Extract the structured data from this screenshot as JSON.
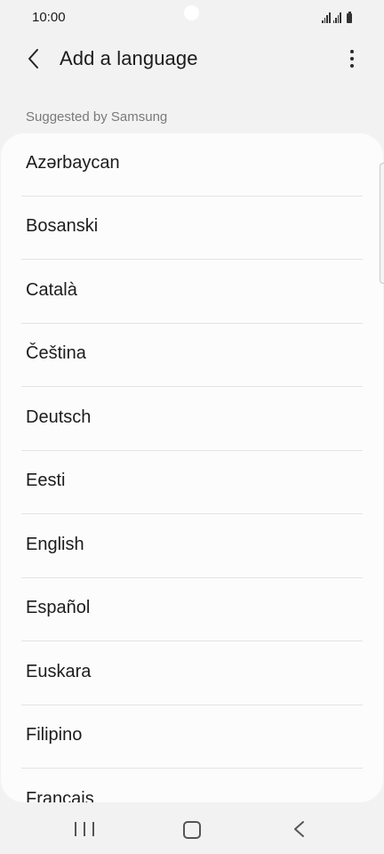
{
  "status_bar": {
    "time": "10:00"
  },
  "header": {
    "title": "Add a language",
    "back_icon": "chevron-left-icon",
    "more_icon": "more-vert-icon"
  },
  "section": {
    "title": "Suggested by Samsung"
  },
  "languages": [
    {
      "label": "Azərbaycan"
    },
    {
      "label": "Bosanski"
    },
    {
      "label": "Català"
    },
    {
      "label": "Čeština"
    },
    {
      "label": "Deutsch"
    },
    {
      "label": "Eesti"
    },
    {
      "label": "English"
    },
    {
      "label": "Español"
    },
    {
      "label": "Euskara"
    },
    {
      "label": "Filipino"
    },
    {
      "label": "Français"
    }
  ],
  "nav_bar": {
    "recents_icon": "recents-icon",
    "home_icon": "home-icon",
    "back_icon": "back-icon"
  }
}
